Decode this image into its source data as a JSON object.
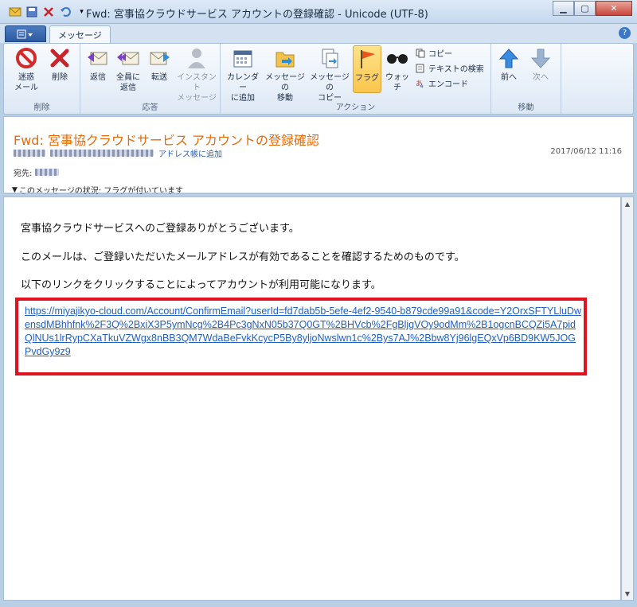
{
  "window": {
    "title": "Fwd: 宮事協クラウドサービス アカウントの登録確認 - Unicode (UTF-8)"
  },
  "tabs": {
    "file_label": "",
    "message_tab": "メッセージ"
  },
  "ribbon": {
    "groups": {
      "delete": "削除",
      "respond": "応答",
      "actions": "アクション",
      "move": "移動"
    },
    "buttons": {
      "junk": "迷惑\nメール",
      "delete": "削除",
      "reply": "返信",
      "reply_all": "全員に\n返信",
      "forward": "転送",
      "instant_message": "インスタント\nメッセージ",
      "add_calendar": "カレンダー\nに追加",
      "move_message": "メッセージの\n移動",
      "copy_message": "メッセージの\nコピー",
      "flag": "フラグ",
      "watch": "ウォッチ",
      "copy": "コピー",
      "find_text": "テキストの検索",
      "encode": "エンコード",
      "previous": "前へ",
      "next": "次へ"
    }
  },
  "header": {
    "subject": "Fwd: 宮事協クラウドサービス アカウントの登録確認",
    "add_to_contacts": "アドレス帳に追加",
    "date": "2017/06/12 11:16",
    "to_label": "宛先:",
    "status": "このメッセージの状況: フラグが付いています"
  },
  "body": {
    "line1": "宮事協クラウドサービスへのご登録ありがとうございます。",
    "line2": "このメールは、ご登録いただいたメールアドレスが有効であることを確認するためのものです。",
    "line3": "以下のリンクをクリックすることによってアカウントが利用可能になります。",
    "link": "https://miyajikyo-cloud.com/Account/ConfirmEmail?userId=fd7dab5b-5efe-4ef2-9540-b879cde99a91&code=Y2OrxSFTYLluDwensdMBhhfnk%2F3Q%2BxiX3P5ymNcg%2B4Pc3gNxN05b37Q0GT%2BHVcb%2FgBljgVOy9odMm%2B1ogcnBCQZi5A7pidQlNUs1lrRypCXaTkuVZWgx8nBB3QM7WdaBeFvkKcycP5By8yljoNwslwn1c%2Bys7AJ%2Bbw8Yj96lgEQxVp6BD9KW5JOGPvdGy9z9"
  },
  "colors": {
    "subject": "#e36c09",
    "link": "#1f5fbf",
    "highlight_box": "#e0141e",
    "flag": "#e8541a"
  }
}
